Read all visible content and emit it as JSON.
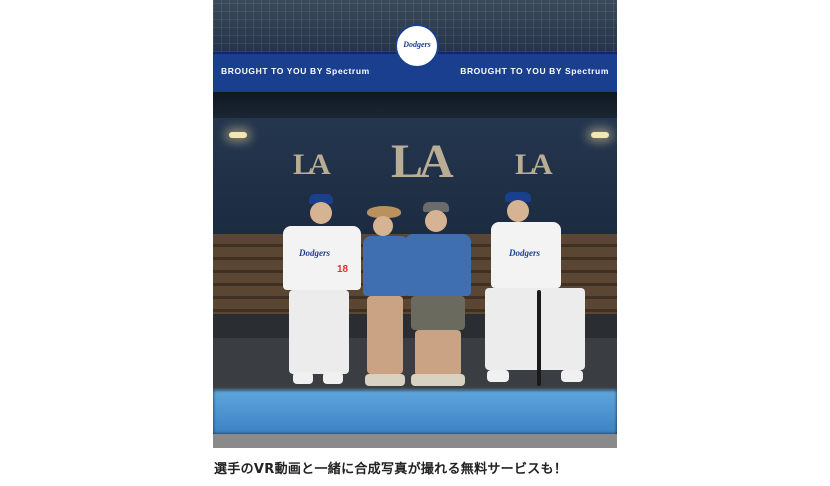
{
  "photo": {
    "banner_left": "BROUGHT TO YOU BY Spectrum",
    "banner_right": "BROUGHT TO YOU BY Spectrum",
    "logo_text": "Dodgers",
    "wall_logo": "LA",
    "jersey_text": "Dodgers",
    "jersey_number": "18"
  },
  "caption": "選手のVR動画と一緒に合成写真が撮れる無料サービスも！",
  "colors": {
    "dodger_blue": "#1a3f8f",
    "rail_blue": "#3d82c3"
  }
}
